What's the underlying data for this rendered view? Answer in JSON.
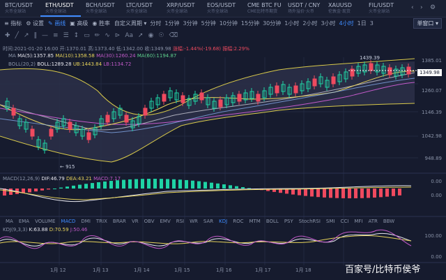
{
  "tabs": [
    {
      "sym": "BTC/USDT",
      "sub": "火币全球站"
    },
    {
      "sym": "ETH/USDT",
      "sub": "火币全球站"
    },
    {
      "sym": "BCH/USDT",
      "sub": "火币全球站"
    },
    {
      "sym": "LTC/USDT",
      "sub": "火币全球站"
    },
    {
      "sym": "XRP/USDT",
      "sub": "火币全球站"
    },
    {
      "sym": "EOS/USDT",
      "sub": "火币全球站"
    },
    {
      "sym": "CME BTC FU",
      "sub": "CME比特币期货"
    },
    {
      "sym": "USDT / CNY",
      "sub": "场外溢价·火币"
    },
    {
      "sym": "XAUUSD",
      "sub": "伦敦金·现货"
    },
    {
      "sym": "FIL/USDT",
      "sub": "火币全球站"
    }
  ],
  "toolbar": {
    "items": [
      "指标",
      "设置",
      "画线",
      "高级",
      "胜率"
    ],
    "custom": "自定义周期",
    "periods": [
      "分时",
      "1分钟",
      "3分钟",
      "5分钟",
      "10分钟",
      "15分钟",
      "30分钟",
      "1小时",
      "2小时",
      "3小时",
      "4小时",
      "1日",
      "3"
    ],
    "dropdown": "单窗口"
  },
  "info": {
    "time": "时间:2021-01-20 16:00",
    "open": "开:1370.01",
    "high": "高:1373.40",
    "low": "低:1342.00",
    "close": "收:1349.98",
    "change": "涨幅:-1.44%(-19.68)",
    "amp": "振幅:2.29%"
  },
  "ma": {
    "name": "MA",
    "v5": "MA(5):1357.85",
    "v10": "MA(10):1358.58",
    "v30": "MA(30):1260.24",
    "v60": "MA(60):1194.87"
  },
  "boll": {
    "name": "BOLL(20,2)",
    "boll": "BOLL:1289.28",
    "ub": "UB:1443.84",
    "lb": "LB:1134.72"
  },
  "macd": {
    "name": "MACD(12,26,9)",
    "dif": "DIF:46.79",
    "dea": "DEA:43.21",
    "macd": "MACD:7.17"
  },
  "kdj": {
    "name": "KDJ(9,3,3)",
    "k": "K:63.88",
    "d": "D:70.59",
    "j": "J:50.46"
  },
  "price_axis": [
    "1385.01",
    "1349.98",
    "1260.07",
    "1146.39",
    "1042.98",
    "948.89"
  ],
  "macd_axis": [
    "0.00",
    "0.00"
  ],
  "kdj_axis": [
    "100.00",
    "0.00"
  ],
  "annotations": {
    "high": "1439.39",
    "low": "915"
  },
  "indicators": [
    "MA",
    "EMA",
    "VOLUME",
    "MACD",
    "DMI",
    "TRIX",
    "BRAR",
    "VR",
    "OBV",
    "EMV",
    "RSI",
    "WR",
    "SAR",
    "KDJ",
    "ROC",
    "MTM",
    "BOLL",
    "PSY",
    "StochRSI",
    "SMI",
    "CCI",
    "MFI",
    "ATR",
    "BBW"
  ],
  "x_labels": [
    "1月 12",
    "1月 13",
    "1月 14",
    "1月 15",
    "1月 16",
    "1月 17",
    "1月 18"
  ],
  "watermark": "百家号/比特币侯爷",
  "colors": {
    "up": "#1fd3a5",
    "down": "#ef4a5f",
    "accent": "#3f8cff",
    "bg": "#161b2e"
  }
}
